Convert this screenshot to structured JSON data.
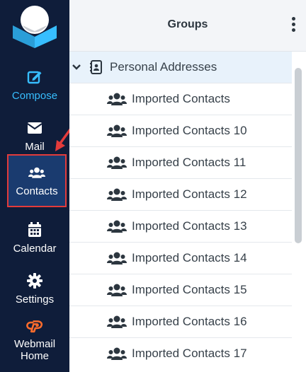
{
  "sidebar": {
    "items": [
      {
        "label": "Compose",
        "icon": "compose-icon"
      },
      {
        "label": "Mail",
        "icon": "envelope-icon"
      },
      {
        "label": "Contacts",
        "icon": "users-icon"
      },
      {
        "label": "Calendar",
        "icon": "calendar-icon"
      },
      {
        "label": "Settings",
        "icon": "gear-icon"
      },
      {
        "label": "Webmail Home",
        "icon": "cpanel-icon"
      }
    ],
    "active": "Contacts",
    "accent_color": "#37beff",
    "highlight_color": "#e33b3b"
  },
  "groups_panel": {
    "title": "Groups",
    "addressbook": {
      "label": "Personal Addresses",
      "icon": "address-book-icon"
    },
    "groups": [
      {
        "label": "Imported Contacts"
      },
      {
        "label": "Imported Contacts 10"
      },
      {
        "label": "Imported Contacts 11"
      },
      {
        "label": "Imported Contacts 12"
      },
      {
        "label": "Imported Contacts 13"
      },
      {
        "label": "Imported Contacts 14"
      },
      {
        "label": "Imported Contacts 15"
      },
      {
        "label": "Imported Contacts 16"
      },
      {
        "label": "Imported Contacts 17"
      }
    ]
  }
}
